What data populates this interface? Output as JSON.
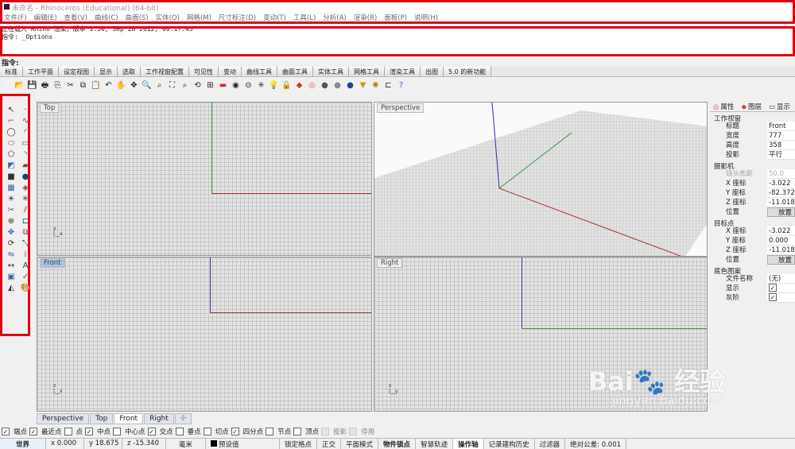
{
  "window": {
    "title": "未命名 - Rhinoceros (Educational) (64-bit)"
  },
  "menu": [
    "文件(F)",
    "编辑(E)",
    "查看(V)",
    "曲线(C)",
    "曲面(S)",
    "实体(O)",
    "网格(M)",
    "尺寸标注(D)",
    "变动(T)",
    "工具(L)",
    "分析(A)",
    "渲染(R)",
    "面板(P)",
    "说明(H)"
  ],
  "history": {
    "line1": "正在载入 Rhino 渲染，版本 1.50, Sep 28 2012, 00:17:43",
    "line2": "指令: _Options"
  },
  "command_prompt": "指令:",
  "toolbar_tabs": [
    "标准",
    "工作平面",
    "设定视图",
    "显示",
    "选取",
    "工作视窗配置",
    "可见性",
    "变动",
    "曲线工具",
    "曲面工具",
    "实体工具",
    "网格工具",
    "渲染工具",
    "出图",
    "5.0 的新功能"
  ],
  "viewports": {
    "top": "Top",
    "perspective": "Perspective",
    "front": "Front",
    "right": "Right"
  },
  "axis_labels": {
    "x": "x",
    "y": "y",
    "z": "z"
  },
  "panel": {
    "tabs": [
      "属性",
      "图层",
      "显示"
    ],
    "sections": [
      {
        "title": "工作视窗",
        "rows": [
          {
            "k": "标题",
            "v": "Front"
          },
          {
            "k": "宽度",
            "v": "777"
          },
          {
            "k": "高度",
            "v": "358"
          },
          {
            "k": "投影",
            "v": "平行"
          }
        ]
      },
      {
        "title": "摄影机",
        "rows": [
          {
            "k": "镜头焦距",
            "v": "50.0"
          },
          {
            "k": "X 座标",
            "v": "-3.022"
          },
          {
            "k": "Y 座标",
            "v": "-82.372"
          },
          {
            "k": "Z 座标",
            "v": "-11.018"
          },
          {
            "k": "位置",
            "v": "放置"
          }
        ]
      },
      {
        "title": "目标点",
        "rows": [
          {
            "k": "X 座标",
            "v": "-3.022"
          },
          {
            "k": "Y 座标",
            "v": "0.000"
          },
          {
            "k": "Z 座标",
            "v": "-11.018"
          },
          {
            "k": "位置",
            "v": "放置"
          }
        ]
      },
      {
        "title": "底色图案",
        "rows": [
          {
            "k": "文件名称",
            "v": "(无)"
          },
          {
            "k": "显示",
            "v": "✓"
          },
          {
            "k": "灰阶",
            "v": "✓"
          }
        ]
      }
    ]
  },
  "view_tabs": [
    "Perspective",
    "Top",
    "Front",
    "Right"
  ],
  "active_view_tab": "Front",
  "osnaps": [
    {
      "label": "端点",
      "checked": true
    },
    {
      "label": "最近点",
      "checked": true
    },
    {
      "label": "点",
      "checked": false
    },
    {
      "label": "中点",
      "checked": true
    },
    {
      "label": "中心点",
      "checked": false
    },
    {
      "label": "交点",
      "checked": true
    },
    {
      "label": "垂点",
      "checked": false
    },
    {
      "label": "切点",
      "checked": false
    },
    {
      "label": "四分点",
      "checked": true
    },
    {
      "label": "节点",
      "checked": false
    },
    {
      "label": "顶点",
      "checked": false
    },
    {
      "label": "投影",
      "checked": false
    },
    {
      "label": "停用",
      "checked": false
    }
  ],
  "status": {
    "cplane": "世界",
    "x": "x 0.000",
    "y": "y 18.675",
    "z": "z -15.340",
    "unit": "毫米",
    "layer": "预设值",
    "grid_snap": "锁定格点",
    "ortho": "正交",
    "planar": "平面模式",
    "osnap": "物件锁点",
    "smarttrack": "智慧轨迹",
    "gumball": "操作轴",
    "history": "记录建构历史",
    "filter": "过滤器",
    "tolerance": "绝对公差: 0.001"
  },
  "watermark": {
    "logo": "Baidu 经验",
    "url": "jingyan.baidu.com"
  },
  "colors": {
    "highlight_box": "#e00010",
    "x_axis": "#b03030",
    "y_axis": "#3a9a3a",
    "z_axis": "#3030a0"
  }
}
